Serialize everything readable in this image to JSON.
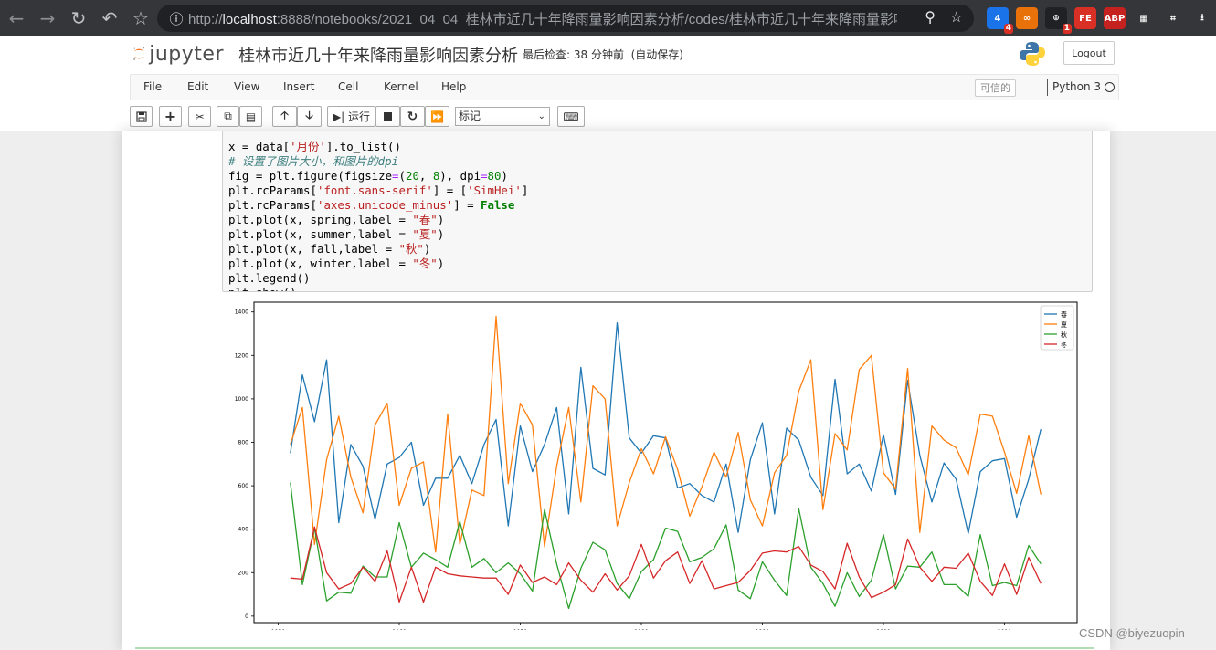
{
  "browser": {
    "url_scheme": "http://",
    "url_host": "localhost",
    "url_rest": ":8888/notebooks/2021_04_04_桂林市近几十年降雨量影响因素分析/codes/桂林市近几十年来降雨量影响...",
    "extensions": [
      {
        "label": "4",
        "color": "#1a73e8",
        "badge": "4"
      },
      {
        "label": "∞",
        "color": "#e8710a",
        "badge": ""
      },
      {
        "label": "⌾",
        "color": "#202124",
        "badge": "1"
      },
      {
        "label": "FE",
        "color": "#d93025",
        "badge": ""
      },
      {
        "label": "ABP",
        "color": "#c5221f",
        "badge": ""
      },
      {
        "label": "▦",
        "color": "#35363a",
        "badge": ""
      },
      {
        "label": "⌗",
        "color": "#35363a",
        "badge": ""
      },
      {
        "label": "⭳",
        "color": "#35363a",
        "badge": ""
      }
    ]
  },
  "header": {
    "logo_text": "jupyter",
    "notebook_title": "桂林市近几十年来降雨量影响因素分析",
    "checkpoint": "最后检查: 38 分钟前",
    "autosave": "(自动保存)",
    "logout": "Logout"
  },
  "menu": {
    "items": [
      "File",
      "Edit",
      "View",
      "Insert",
      "Cell",
      "Kernel",
      "Help"
    ],
    "trusted": "可信的",
    "kernel": "Python 3"
  },
  "toolbar": {
    "run_label": "运行",
    "cell_type": "标记"
  },
  "code": {
    "lines": [
      "x = data['月份'].to_list()",
      "# 设置了图片大小，和图片的dpi",
      "fig = plt.figure(figsize=(20, 8), dpi=80)",
      "plt.rcParams['font.sans-serif'] = ['SimHei']",
      "plt.rcParams['axes.unicode_minus'] = False",
      "plt.plot(x, spring,label = \"春\")",
      "plt.plot(x, summer,label = \"夏\")",
      "plt.plot(x, fall,label = \"秋\")",
      "plt.plot(x, winter,label = \"冬\")",
      "plt.legend()",
      "plt.show()"
    ]
  },
  "chart_data": {
    "type": "line",
    "xlim": [
      1948,
      2016
    ],
    "ylim": [
      -30,
      1445
    ],
    "xticks": [
      1950,
      1960,
      1970,
      1980,
      1990,
      2000,
      2010
    ],
    "yticks": [
      0,
      200,
      400,
      600,
      800,
      1000,
      1200,
      1400
    ],
    "legend_position": "top-right",
    "grid": false,
    "x": [
      1951,
      1952,
      1953,
      1954,
      1955,
      1956,
      1957,
      1958,
      1959,
      1960,
      1961,
      1962,
      1963,
      1964,
      1965,
      1966,
      1967,
      1968,
      1969,
      1970,
      1971,
      1972,
      1973,
      1974,
      1975,
      1976,
      1977,
      1978,
      1979,
      1980,
      1981,
      1982,
      1983,
      1984,
      1985,
      1986,
      1987,
      1988,
      1989,
      1990,
      1991,
      1992,
      1993,
      1994,
      1995,
      1996,
      1997,
      1998,
      1999,
      2000,
      2001,
      2002,
      2003,
      2004,
      2005,
      2006,
      2007,
      2008,
      2009,
      2010,
      2011,
      2012,
      2013
    ],
    "series": [
      {
        "name": "春",
        "color": "#1f77b4",
        "values": [
          750,
          1110,
          895,
          1180,
          430,
          790,
          690,
          445,
          700,
          730,
          800,
          510,
          635,
          635,
          740,
          610,
          790,
          905,
          415,
          875,
          665,
          790,
          960,
          470,
          1145,
          680,
          650,
          1350,
          820,
          750,
          830,
          820,
          590,
          610,
          555,
          525,
          700,
          385,
          720,
          890,
          470,
          865,
          810,
          640,
          555,
          1090,
          655,
          700,
          575,
          835,
          560,
          1085,
          740,
          525,
          705,
          630,
          380,
          665,
          715,
          725,
          455,
          630,
          860
        ]
      },
      {
        "name": "夏",
        "color": "#ff7f0e",
        "values": [
          790,
          960,
          330,
          720,
          920,
          640,
          475,
          880,
          980,
          510,
          680,
          710,
          295,
          930,
          330,
          580,
          555,
          1380,
          610,
          980,
          880,
          320,
          690,
          960,
          525,
          1060,
          1000,
          415,
          615,
          770,
          655,
          825,
          675,
          460,
          595,
          755,
          640,
          845,
          535,
          415,
          660,
          740,
          1035,
          1180,
          490,
          840,
          765,
          1135,
          1200,
          660,
          585,
          1140,
          385,
          875,
          810,
          775,
          650,
          930,
          920,
          755,
          565,
          830,
          560
        ]
      },
      {
        "name": "秋",
        "color": "#2ca02c",
        "values": [
          615,
          145,
          405,
          70,
          110,
          105,
          230,
          180,
          180,
          430,
          225,
          290,
          260,
          225,
          435,
          225,
          265,
          200,
          245,
          195,
          115,
          490,
          240,
          35,
          220,
          340,
          305,
          150,
          80,
          205,
          260,
          405,
          390,
          250,
          270,
          310,
          420,
          120,
          80,
          250,
          165,
          95,
          495,
          225,
          150,
          45,
          200,
          90,
          165,
          375,
          125,
          230,
          225,
          295,
          145,
          145,
          90,
          375,
          140,
          155,
          140,
          325,
          240
        ]
      },
      {
        "name": "冬",
        "color": "#d62728",
        "values": [
          175,
          170,
          410,
          200,
          125,
          150,
          225,
          160,
          300,
          65,
          225,
          65,
          225,
          195,
          185,
          180,
          175,
          175,
          100,
          235,
          155,
          180,
          145,
          245,
          165,
          110,
          195,
          120,
          185,
          330,
          175,
          255,
          295,
          150,
          255,
          125,
          140,
          155,
          210,
          290,
          300,
          295,
          320,
          235,
          205,
          125,
          335,
          180,
          85,
          110,
          145,
          355,
          225,
          160,
          225,
          220,
          290,
          160,
          95,
          240,
          100,
          270,
          150
        ]
      }
    ]
  },
  "watermark": "CSDN @biyezuopin"
}
